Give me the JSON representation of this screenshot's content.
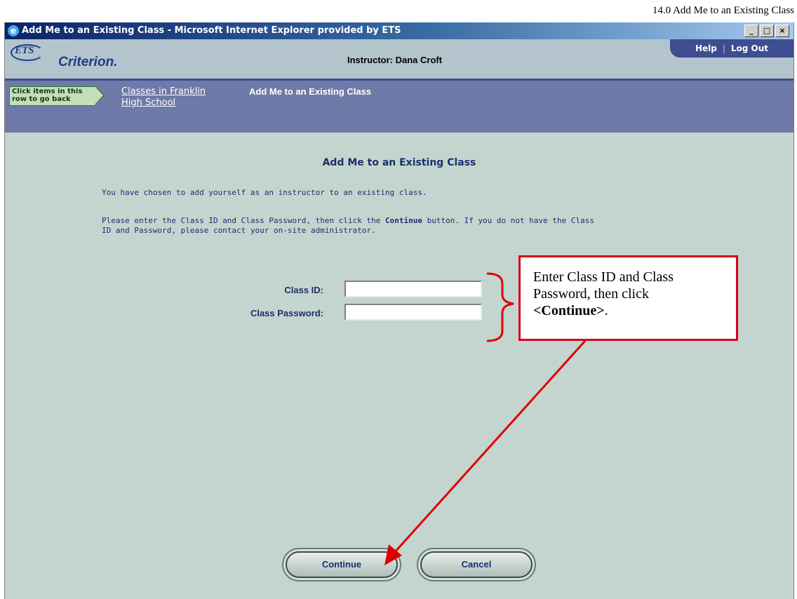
{
  "doc_header": "14.0 Add Me to an Existing Class",
  "window": {
    "title": "Add Me to an Existing Class - Microsoft Internet Explorer provided by ETS",
    "controls": {
      "minimize": "_",
      "maximize": "□",
      "close": "×"
    }
  },
  "app_header": {
    "logo_ets": "ETS",
    "logo_criterion": "Criterion.",
    "instructor": "Instructor: Dana Croft",
    "help": "Help",
    "separator": "|",
    "logout": "Log Out"
  },
  "breadcrumb": {
    "hint_line1": "Click items in this",
    "hint_line2": "row to go back",
    "link_line1": "Classes in Franklin",
    "link_line2": "High School",
    "current": "Add Me to an Existing Class"
  },
  "main": {
    "heading": "Add Me to an Existing Class",
    "intro": "You have chosen to add yourself as an instructor to an existing class.",
    "instr_before": "Please enter the Class ID and Class Password, then click the ",
    "instr_bold": "Continue",
    "instr_after": " button. If you do not have the Class",
    "instr_line2": "ID and Password, please contact your on-site administrator.",
    "class_id_label": "Class ID:",
    "class_id_value": "",
    "class_password_label": "Class Password:",
    "class_password_value": ""
  },
  "buttons": {
    "continue": "Continue",
    "cancel": "Cancel"
  },
  "callout": {
    "text_line1": "Enter Class ID and Class",
    "text_line2": "Password, then click",
    "text_bold": "<Continue>",
    "text_end": "."
  },
  "colors": {
    "annotation_red": "#e00000",
    "page_background": "#c4d5d0",
    "navy_text": "#1b2f6b"
  }
}
